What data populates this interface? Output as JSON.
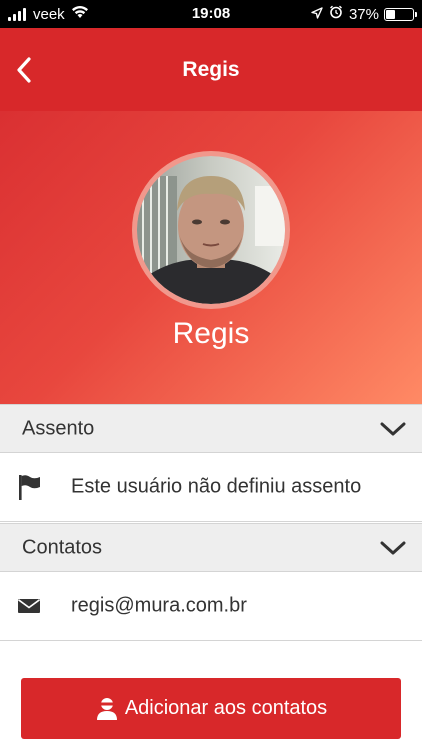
{
  "status_bar": {
    "carrier": "veek",
    "time": "19:08",
    "battery_percent": "37%",
    "battery_level": 0.37,
    "icons": [
      "signal-icon",
      "wifi-icon",
      "location-icon",
      "alarm-icon",
      "battery-icon"
    ]
  },
  "nav": {
    "title": "Regis",
    "back_icon": "chevron-left-icon"
  },
  "profile": {
    "name": "Regis",
    "avatar_description": "user-photo"
  },
  "sections": {
    "seat": {
      "title": "Assento",
      "icon": "flag-icon",
      "value": "Este usuário não definiu assento"
    },
    "contacts": {
      "title": "Contatos",
      "icon": "envelope-icon",
      "value": "regis@mura.com.br"
    }
  },
  "actions": {
    "add_contact_label": "Adicionar aos contatos",
    "add_contact_icon": "user-icon"
  },
  "colors": {
    "primary": "#d8282a",
    "gradient_start": "#da3032",
    "gradient_end": "#ff8a65",
    "section_bg": "#eeeeee",
    "text": "#333333"
  }
}
